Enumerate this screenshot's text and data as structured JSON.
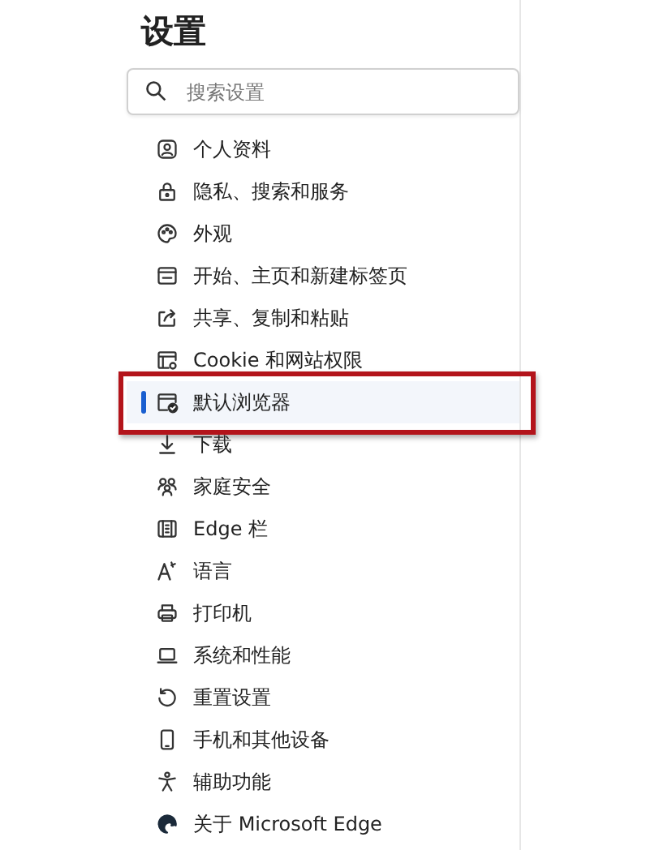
{
  "title": "设置",
  "search": {
    "placeholder": "搜索设置"
  },
  "items": [
    {
      "label": "个人资料",
      "selected": false,
      "highlighted": false
    },
    {
      "label": "隐私、搜索和服务",
      "selected": false,
      "highlighted": false
    },
    {
      "label": "外观",
      "selected": false,
      "highlighted": false
    },
    {
      "label": "开始、主页和新建标签页",
      "selected": false,
      "highlighted": false
    },
    {
      "label": "共享、复制和粘贴",
      "selected": false,
      "highlighted": false
    },
    {
      "label": "Cookie 和网站权限",
      "selected": false,
      "highlighted": false
    },
    {
      "label": "默认浏览器",
      "selected": true,
      "highlighted": true
    },
    {
      "label": "下载",
      "selected": false,
      "highlighted": false
    },
    {
      "label": "家庭安全",
      "selected": false,
      "highlighted": false
    },
    {
      "label": "Edge 栏",
      "selected": false,
      "highlighted": false
    },
    {
      "label": "语言",
      "selected": false,
      "highlighted": false
    },
    {
      "label": "打印机",
      "selected": false,
      "highlighted": false
    },
    {
      "label": "系统和性能",
      "selected": false,
      "highlighted": false
    },
    {
      "label": "重置设置",
      "selected": false,
      "highlighted": false
    },
    {
      "label": "手机和其他设备",
      "selected": false,
      "highlighted": false
    },
    {
      "label": "辅助功能",
      "selected": false,
      "highlighted": false
    },
    {
      "label": "关于 Microsoft Edge",
      "selected": false,
      "highlighted": false
    }
  ]
}
